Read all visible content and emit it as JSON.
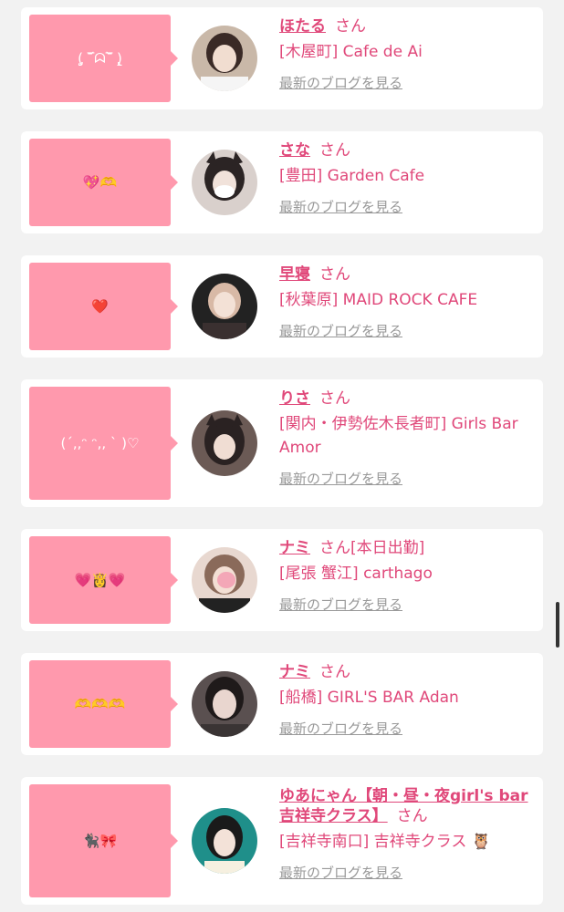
{
  "entries": [
    {
      "bubble": "(̨̡ ‾᷄ᗣ‾᷅ )̧̢",
      "name": "ほたる",
      "san": "さん",
      "extra": "",
      "shop": "[木屋町] Cafe de Ai",
      "blog": "最新のブログを見る",
      "avatar_colors": [
        "#c9b8a8",
        "#3a2a26"
      ]
    },
    {
      "bubble": "💖🫶",
      "name": "さな",
      "san": "さん",
      "extra": "",
      "shop": "[豊田] Garden Cafe",
      "blog": "最新のブログを見る",
      "avatar_colors": [
        "#d9d0cc",
        "#2b2424"
      ]
    },
    {
      "bubble": "❤️",
      "name": "早寝",
      "san": "さん",
      "extra": "",
      "shop": "[秋葉原] MAID ROCK CAFE",
      "blog": "最新のブログを見る",
      "avatar_colors": [
        "#222222",
        "#d8b9a6"
      ]
    },
    {
      "bubble": "(´,,ᵔ ᵔ,, ` )♡",
      "name": "りさ",
      "san": "さん",
      "extra": "",
      "shop": "[関内・伊勢佐木長者町] Girls Bar Amor",
      "blog": "最新のブログを見る",
      "avatar_colors": [
        "#6b5a55",
        "#2a2222"
      ]
    },
    {
      "bubble": "💗👸💗",
      "name": "ナミ",
      "san": "さん",
      "extra": "[本日出勤]",
      "shop": "[尾張 蟹江] carthago",
      "blog": "最新のブログを見る",
      "avatar_colors": [
        "#e8d8d0",
        "#f3a7b7"
      ]
    },
    {
      "bubble": "🫶🫶🫶",
      "name": "ナミ",
      "san": "さん",
      "extra": "",
      "shop": "[船橋] GIRL'S BAR Adan",
      "blog": "最新のブログを見る",
      "avatar_colors": [
        "#5a5050",
        "#e9d6cf"
      ]
    },
    {
      "bubble": "🐈‍⬛🎀",
      "name": "ゆあにゃん【朝・昼・夜girl's bar吉祥寺クラス】",
      "san": "さん",
      "extra": "",
      "shop": "[吉祥寺南口] 吉祥寺クラス 🦉",
      "blog": "最新のブログを見る",
      "avatar_colors": [
        "#1f8f8a",
        "#1a1a1a"
      ]
    }
  ]
}
